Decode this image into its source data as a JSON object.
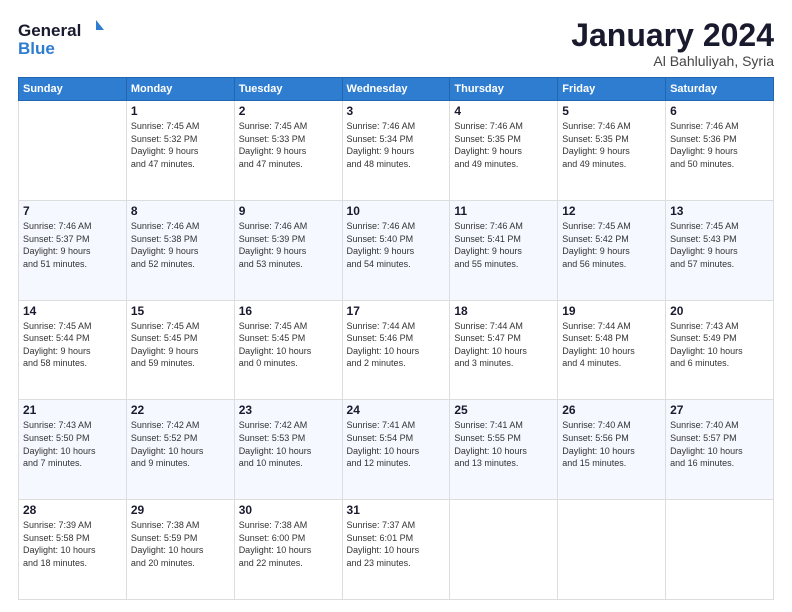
{
  "logo": {
    "line1": "General",
    "line2": "Blue"
  },
  "title": "January 2024",
  "subtitle": "Al Bahluliyah, Syria",
  "days_header": [
    "Sunday",
    "Monday",
    "Tuesday",
    "Wednesday",
    "Thursday",
    "Friday",
    "Saturday"
  ],
  "weeks": [
    {
      "alt": false,
      "days": [
        {
          "num": "",
          "info": ""
        },
        {
          "num": "1",
          "info": "Sunrise: 7:45 AM\nSunset: 5:32 PM\nDaylight: 9 hours\nand 47 minutes."
        },
        {
          "num": "2",
          "info": "Sunrise: 7:45 AM\nSunset: 5:33 PM\nDaylight: 9 hours\nand 47 minutes."
        },
        {
          "num": "3",
          "info": "Sunrise: 7:46 AM\nSunset: 5:34 PM\nDaylight: 9 hours\nand 48 minutes."
        },
        {
          "num": "4",
          "info": "Sunrise: 7:46 AM\nSunset: 5:35 PM\nDaylight: 9 hours\nand 49 minutes."
        },
        {
          "num": "5",
          "info": "Sunrise: 7:46 AM\nSunset: 5:35 PM\nDaylight: 9 hours\nand 49 minutes."
        },
        {
          "num": "6",
          "info": "Sunrise: 7:46 AM\nSunset: 5:36 PM\nDaylight: 9 hours\nand 50 minutes."
        }
      ]
    },
    {
      "alt": true,
      "days": [
        {
          "num": "7",
          "info": "Sunrise: 7:46 AM\nSunset: 5:37 PM\nDaylight: 9 hours\nand 51 minutes."
        },
        {
          "num": "8",
          "info": "Sunrise: 7:46 AM\nSunset: 5:38 PM\nDaylight: 9 hours\nand 52 minutes."
        },
        {
          "num": "9",
          "info": "Sunrise: 7:46 AM\nSunset: 5:39 PM\nDaylight: 9 hours\nand 53 minutes."
        },
        {
          "num": "10",
          "info": "Sunrise: 7:46 AM\nSunset: 5:40 PM\nDaylight: 9 hours\nand 54 minutes."
        },
        {
          "num": "11",
          "info": "Sunrise: 7:46 AM\nSunset: 5:41 PM\nDaylight: 9 hours\nand 55 minutes."
        },
        {
          "num": "12",
          "info": "Sunrise: 7:45 AM\nSunset: 5:42 PM\nDaylight: 9 hours\nand 56 minutes."
        },
        {
          "num": "13",
          "info": "Sunrise: 7:45 AM\nSunset: 5:43 PM\nDaylight: 9 hours\nand 57 minutes."
        }
      ]
    },
    {
      "alt": false,
      "days": [
        {
          "num": "14",
          "info": "Sunrise: 7:45 AM\nSunset: 5:44 PM\nDaylight: 9 hours\nand 58 minutes."
        },
        {
          "num": "15",
          "info": "Sunrise: 7:45 AM\nSunset: 5:45 PM\nDaylight: 9 hours\nand 59 minutes."
        },
        {
          "num": "16",
          "info": "Sunrise: 7:45 AM\nSunset: 5:45 PM\nDaylight: 10 hours\nand 0 minutes."
        },
        {
          "num": "17",
          "info": "Sunrise: 7:44 AM\nSunset: 5:46 PM\nDaylight: 10 hours\nand 2 minutes."
        },
        {
          "num": "18",
          "info": "Sunrise: 7:44 AM\nSunset: 5:47 PM\nDaylight: 10 hours\nand 3 minutes."
        },
        {
          "num": "19",
          "info": "Sunrise: 7:44 AM\nSunset: 5:48 PM\nDaylight: 10 hours\nand 4 minutes."
        },
        {
          "num": "20",
          "info": "Sunrise: 7:43 AM\nSunset: 5:49 PM\nDaylight: 10 hours\nand 6 minutes."
        }
      ]
    },
    {
      "alt": true,
      "days": [
        {
          "num": "21",
          "info": "Sunrise: 7:43 AM\nSunset: 5:50 PM\nDaylight: 10 hours\nand 7 minutes."
        },
        {
          "num": "22",
          "info": "Sunrise: 7:42 AM\nSunset: 5:52 PM\nDaylight: 10 hours\nand 9 minutes."
        },
        {
          "num": "23",
          "info": "Sunrise: 7:42 AM\nSunset: 5:53 PM\nDaylight: 10 hours\nand 10 minutes."
        },
        {
          "num": "24",
          "info": "Sunrise: 7:41 AM\nSunset: 5:54 PM\nDaylight: 10 hours\nand 12 minutes."
        },
        {
          "num": "25",
          "info": "Sunrise: 7:41 AM\nSunset: 5:55 PM\nDaylight: 10 hours\nand 13 minutes."
        },
        {
          "num": "26",
          "info": "Sunrise: 7:40 AM\nSunset: 5:56 PM\nDaylight: 10 hours\nand 15 minutes."
        },
        {
          "num": "27",
          "info": "Sunrise: 7:40 AM\nSunset: 5:57 PM\nDaylight: 10 hours\nand 16 minutes."
        }
      ]
    },
    {
      "alt": false,
      "days": [
        {
          "num": "28",
          "info": "Sunrise: 7:39 AM\nSunset: 5:58 PM\nDaylight: 10 hours\nand 18 minutes."
        },
        {
          "num": "29",
          "info": "Sunrise: 7:38 AM\nSunset: 5:59 PM\nDaylight: 10 hours\nand 20 minutes."
        },
        {
          "num": "30",
          "info": "Sunrise: 7:38 AM\nSunset: 6:00 PM\nDaylight: 10 hours\nand 22 minutes."
        },
        {
          "num": "31",
          "info": "Sunrise: 7:37 AM\nSunset: 6:01 PM\nDaylight: 10 hours\nand 23 minutes."
        },
        {
          "num": "",
          "info": ""
        },
        {
          "num": "",
          "info": ""
        },
        {
          "num": "",
          "info": ""
        }
      ]
    }
  ]
}
